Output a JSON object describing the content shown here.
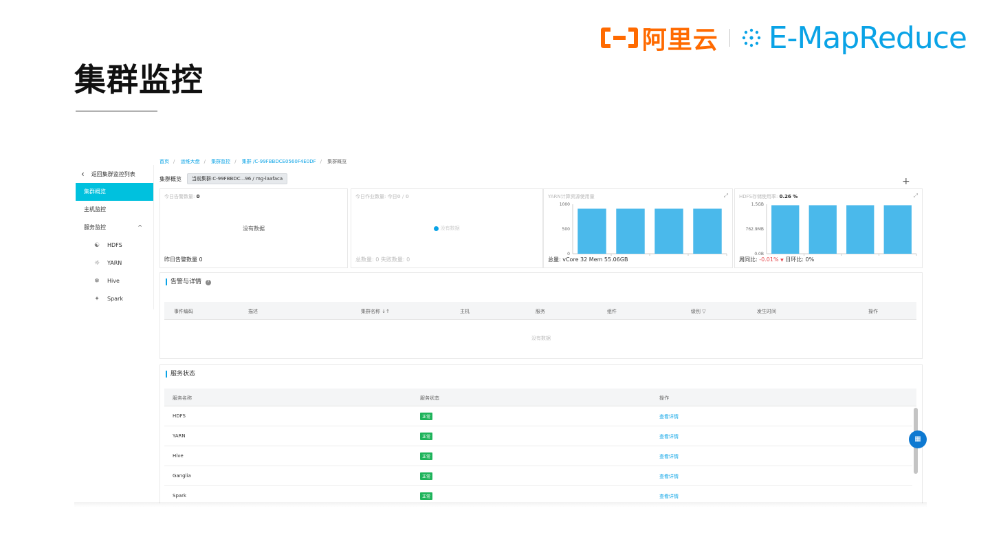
{
  "slide": {
    "title": "集群监控",
    "brand_cn": "阿里云",
    "brand_en": "E-MapReduce",
    "brand_color": "#ff6a00",
    "brand_en_color": "#0aa3e6"
  },
  "sidebar": {
    "back": "返回集群监控列表",
    "items": [
      {
        "label": "集群概览",
        "active": true
      },
      {
        "label": "主机监控",
        "active": false
      }
    ],
    "group": {
      "label": "服务监控",
      "chevron": "^"
    },
    "services": [
      {
        "label": "HDFS",
        "icon": "hdfs-icon"
      },
      {
        "label": "YARN",
        "icon": "yarn-icon"
      },
      {
        "label": "Hive",
        "icon": "hive-icon"
      },
      {
        "label": "Spark",
        "icon": "spark-icon"
      }
    ]
  },
  "breadcrumb": [
    "首页",
    "运维大盘",
    "集群监控",
    "集群 /C-99FBBDCE0560F4E0DF",
    "集群概览"
  ],
  "cluster": {
    "label": "集群概览",
    "current": "当前集群:C-99FBBDC...96 / mg-laafaca"
  },
  "cards": {
    "alarm_today": {
      "head": "今日告警数量:",
      "value": "0",
      "empty": "没有数据",
      "foot": "昨日告警数量 0"
    },
    "job_today": {
      "head": "今日作业数量:",
      "value": "今日0 / 0",
      "loading": "没有数据",
      "foot": "总数量: 0 失败数量: 0"
    },
    "yarn": {
      "head": "YARN计算资源使用量",
      "foot": "总量: vCore 32 Mem 55.06GB"
    },
    "hdfs": {
      "head": "HDFS存储使用率:",
      "value": "0.26 %",
      "foot_prefix": "周同比:",
      "foot_wow": "-0.01%",
      "foot_rest": "日环比: 0%"
    }
  },
  "chart_data": [
    {
      "type": "bar",
      "title": "YARN计算资源使用量",
      "categories": [
        "",
        "",
        "",
        ""
      ],
      "values": [
        910,
        910,
        910,
        910
      ],
      "ylim": [
        0,
        1000
      ],
      "yticks": [
        "0",
        "500",
        "1000"
      ],
      "grid": false,
      "color": "#4ab9eb"
    },
    {
      "type": "bar",
      "title": "HDFS存储使用率",
      "categories": [
        "",
        "",
        "",
        ""
      ],
      "values": [
        98,
        98,
        98,
        98
      ],
      "ylim": [
        0,
        100
      ],
      "yticks": [
        "0.0B",
        "762.9MB",
        "1.5GB"
      ],
      "grid": false,
      "color": "#4ab9eb"
    }
  ],
  "alarms": {
    "title": "告警与详情",
    "columns": [
      "事件编码",
      "描述",
      "集群名称 ↓↑",
      "主机",
      "服务",
      "组件",
      "级别 ▽",
      "发生时间",
      "操作"
    ],
    "empty": "没有数据"
  },
  "services_status": {
    "title": "服务状态",
    "columns": [
      "服务名称",
      "服务状态",
      "操作"
    ],
    "rows": [
      {
        "name": "HDFS",
        "status": "正常",
        "action": "查看详情"
      },
      {
        "name": "YARN",
        "status": "正常",
        "action": "查看详情"
      },
      {
        "name": "Hive",
        "status": "正常",
        "action": "查看详情"
      },
      {
        "name": "Ganglia",
        "status": "正常",
        "action": "查看详情"
      },
      {
        "name": "Spark",
        "status": "正常",
        "action": "查看详情"
      }
    ],
    "status_color": "#1fb35b"
  }
}
